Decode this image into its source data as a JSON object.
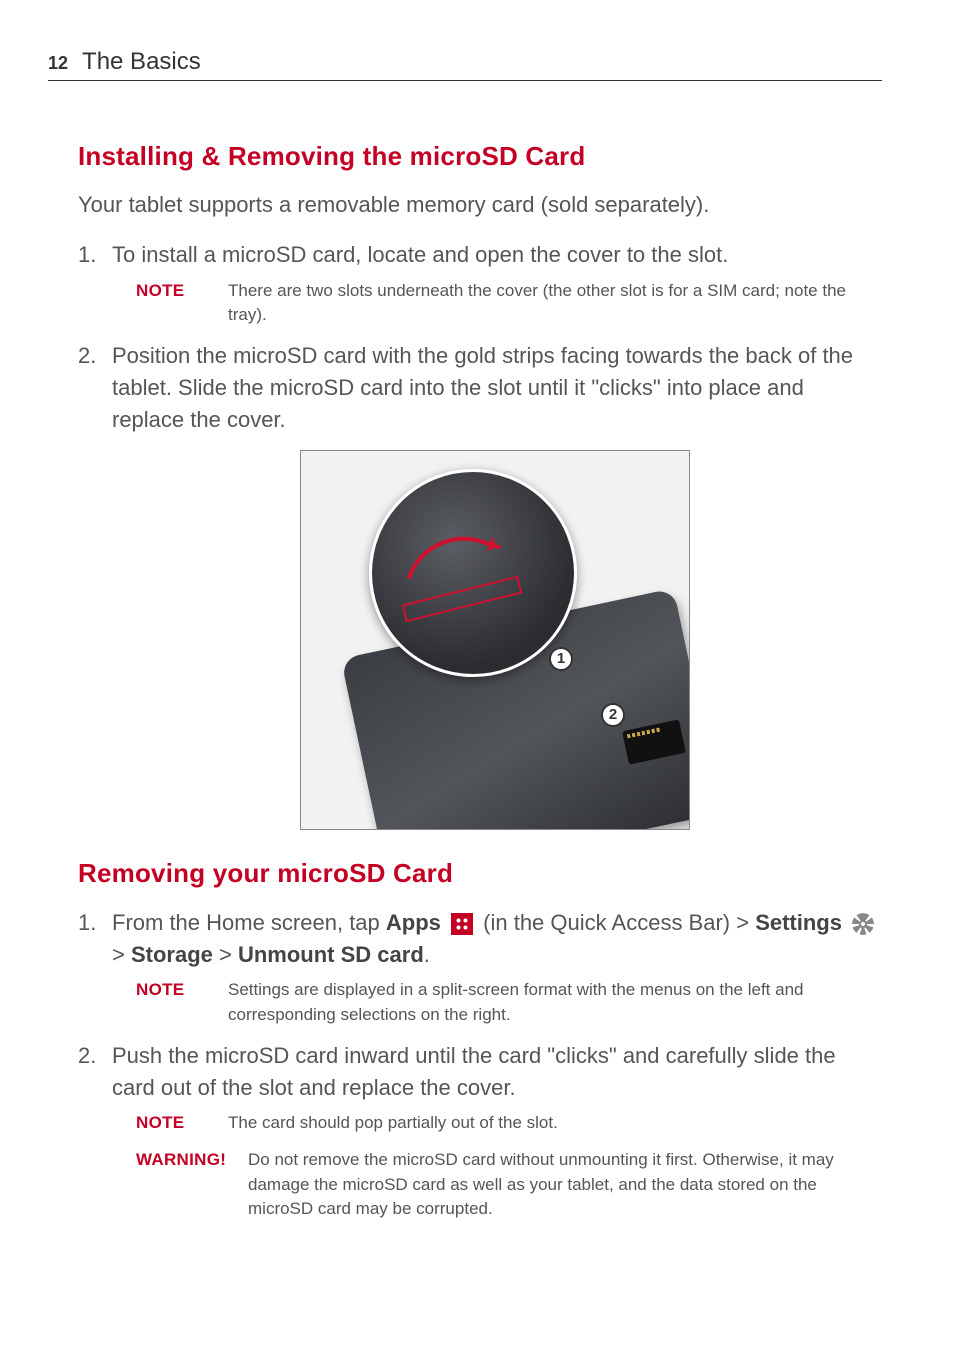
{
  "page_number": "12",
  "header_title": "The Basics",
  "section1": {
    "heading": "Installing & Removing the microSD Card",
    "lead": "Your tablet supports a removable memory card (sold separately).",
    "step1": "To install a microSD card, locate and open the cover to the slot.",
    "note1_label": "NOTE",
    "note1_text": "There are two slots underneath the cover (the other slot is for a SIM card; note the tray).",
    "step2": "Position the microSD card with the gold strips facing towards the back of the tablet. Slide the microSD card into the slot until it \"clicks\" into place and replace the cover.",
    "callout1": "1",
    "callout2": "2"
  },
  "section2": {
    "heading": "Removing your microSD Card",
    "step1_pre": "From the Home screen, tap ",
    "step1_apps": "Apps",
    "step1_mid": " (in the Quick Access Bar) > ",
    "step1_settings": "Settings",
    "step1_post1": " > ",
    "step1_storage": "Storage",
    "step1_post2": " > ",
    "step1_unmount": "Unmount SD card",
    "step1_end": ".",
    "note1_label": "NOTE",
    "note1_text": "Settings are displayed in a split-screen format with the menus on the left and corresponding selections on the right.",
    "step2": "Push the microSD card inward until the card \"clicks\" and carefully slide the card out of the slot and replace the cover.",
    "note2_label": "NOTE",
    "note2_text": "The card should pop partially out of the slot.",
    "warning_label": "WARNING!",
    "warning_text": "Do not remove the microSD card without unmounting it first. Otherwise, it may damage the microSD card as well as your tablet, and the data stored on the microSD card may be corrupted."
  }
}
